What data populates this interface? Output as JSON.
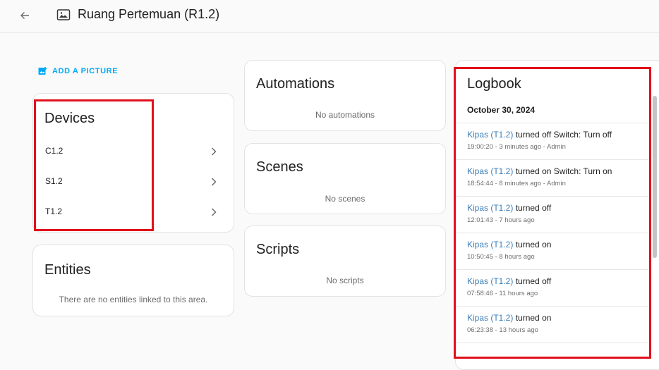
{
  "header": {
    "title": "Ruang Pertemuan (R1.2)"
  },
  "left": {
    "add_picture_label": "ADD A PICTURE",
    "devices": {
      "title": "Devices",
      "items": [
        {
          "label": "C1.2"
        },
        {
          "label": "S1.2"
        },
        {
          "label": "T1.2"
        }
      ]
    },
    "entities": {
      "title": "Entities",
      "empty": "There are no entities linked to this area."
    }
  },
  "middle": {
    "automations": {
      "title": "Automations",
      "empty": "No automations"
    },
    "scenes": {
      "title": "Scenes",
      "empty": "No scenes"
    },
    "scripts": {
      "title": "Scripts",
      "empty": "No scripts"
    }
  },
  "logbook": {
    "title": "Logbook",
    "date": "October 30, 2024",
    "entries": [
      {
        "entity": "Kipas (T1.2)",
        "action": "turned off Switch: Turn off",
        "meta": "19:00:20 - 3 minutes ago - Admin"
      },
      {
        "entity": "Kipas (T1.2)",
        "action": "turned on Switch: Turn on",
        "meta": "18:54:44 - 8 minutes ago - Admin"
      },
      {
        "entity": "Kipas (T1.2)",
        "action": "turned off",
        "meta": "12:01:43 - 7 hours ago"
      },
      {
        "entity": "Kipas (T1.2)",
        "action": "turned on",
        "meta": "10:50:45 - 8 hours ago"
      },
      {
        "entity": "Kipas (T1.2)",
        "action": "turned off",
        "meta": "07:58:46 - 11 hours ago"
      },
      {
        "entity": "Kipas (T1.2)",
        "action": "turned on",
        "meta": "06:23:38 - 13 hours ago"
      }
    ]
  },
  "colors": {
    "accent": "#03a9f4",
    "entity_link": "#3d7fb8",
    "highlight": "#e0101b"
  }
}
